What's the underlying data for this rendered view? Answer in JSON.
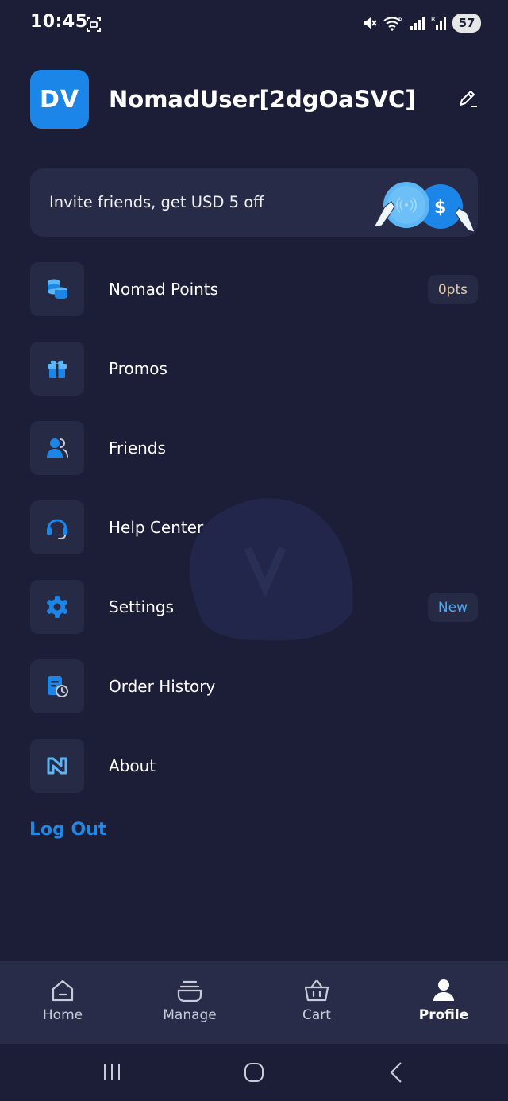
{
  "status_bar": {
    "time": "10:45",
    "battery": "57",
    "icons": [
      "screenshot-icon",
      "mute-icon",
      "wifi-icon",
      "signal-icon",
      "signal-r-icon"
    ]
  },
  "profile": {
    "avatar_initials": "DV",
    "username": "NomadUser[2dgOaSVC]",
    "edit_icon": "pencil-icon"
  },
  "invite_banner": {
    "text": "Invite friends, get USD 5 off",
    "art": "coins-hands-illustration"
  },
  "menu": {
    "items": [
      {
        "label": "Nomad Points",
        "icon": "coins-icon",
        "badge": "0pts"
      },
      {
        "label": "Promos",
        "icon": "gift-icon"
      },
      {
        "label": "Friends",
        "icon": "friends-icon"
      },
      {
        "label": "Help Center",
        "icon": "headset-icon"
      },
      {
        "label": "Settings",
        "icon": "gear-icon",
        "badge": "New"
      },
      {
        "label": "Order History",
        "icon": "order-history-icon"
      },
      {
        "label": "About",
        "icon": "nomad-logo-icon"
      }
    ]
  },
  "logout_label": "Log Out",
  "tabbar": {
    "tabs": [
      {
        "label": "Home",
        "icon": "home-icon"
      },
      {
        "label": "Manage",
        "icon": "manage-icon"
      },
      {
        "label": "Cart",
        "icon": "basket-icon"
      },
      {
        "label": "Profile",
        "icon": "person-icon",
        "active": true
      }
    ]
  },
  "colors": {
    "background": "#1b1e36",
    "card": "#262a45",
    "accent": "#1c86e8",
    "badge_points": "#e5c8a8",
    "badge_new": "#4fa8f0"
  }
}
